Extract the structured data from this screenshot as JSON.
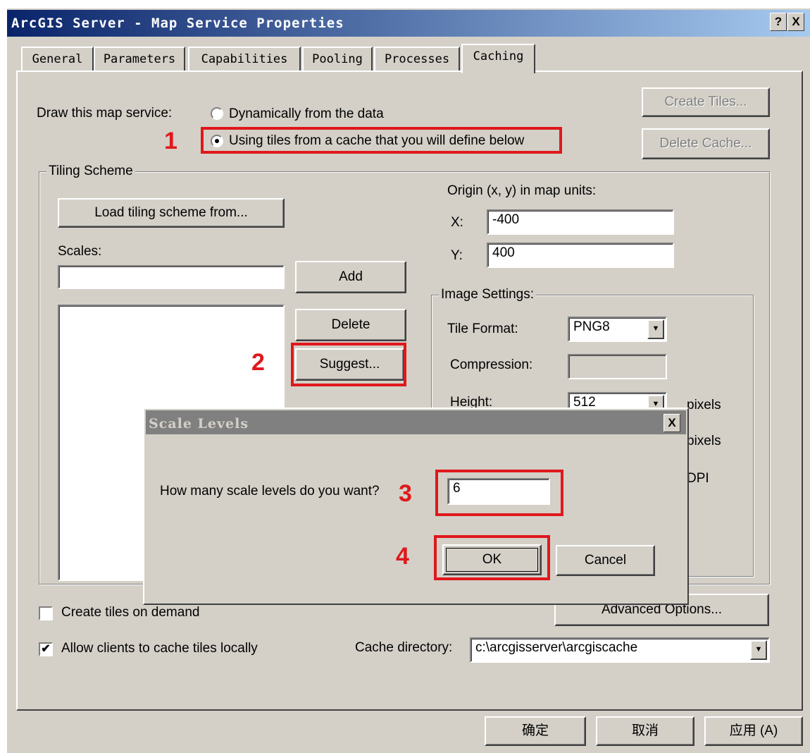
{
  "window": {
    "title": "ArcGIS Server - Map Service Properties",
    "help_button": "?",
    "close_button": "X"
  },
  "tabs": [
    "General",
    "Parameters",
    "Capabilities",
    "Pooling",
    "Processes",
    "Caching"
  ],
  "active_tab": "Caching",
  "draw": {
    "label": "Draw this map service:",
    "option_dynamic": "Dynamically from the data",
    "option_cache": "Using tiles from a cache that you will define below",
    "selected": "cache"
  },
  "buttons": {
    "create_tiles": "Create Tiles...",
    "delete_cache": "Delete Cache...",
    "load_tiling_scheme": "Load tiling scheme from...",
    "add": "Add",
    "delete": "Delete",
    "suggest": "Suggest...",
    "advanced_options": "Advanced Options..."
  },
  "tiling_scheme": {
    "group_label": "Tiling Scheme",
    "scales_label": "Scales:",
    "scales_value": "",
    "origin_label": "Origin (x, y) in map units:",
    "x_label": "X:",
    "x_value": "-400",
    "y_label": "Y:",
    "y_value": "400"
  },
  "image_settings": {
    "group_label": "Image Settings:",
    "tile_format_label": "Tile Format:",
    "tile_format_value": "PNG8",
    "compression_label": "Compression:",
    "compression_value": "",
    "height_label": "Height:",
    "height_value": "512",
    "pixels_unit": "pixels",
    "pixels_unit_2": "pixels",
    "dpi_unit": "DPI"
  },
  "options": {
    "create_on_demand": "Create tiles on demand",
    "create_on_demand_checked": false,
    "allow_clients_cache": "Allow clients to cache tiles locally",
    "allow_clients_cache_checked": true,
    "cache_dir_label": "Cache directory:",
    "cache_dir_value": "c:\\arcgisserver\\arcgiscache"
  },
  "footer": {
    "ok": "确定",
    "cancel": "取消",
    "apply": "应用 (A)"
  },
  "dialog": {
    "title": "Scale Levels",
    "close": "X",
    "prompt": "How many scale levels do you want?",
    "value": "6",
    "ok": "OK",
    "cancel": "Cancel"
  },
  "annotations": [
    "1",
    "2",
    "3",
    "4"
  ],
  "colors": {
    "annotation_red": "#e0181c",
    "titlebar_start": "#0a246a",
    "titlebar_end": "#a6caf0",
    "face": "#d4d0c8"
  }
}
